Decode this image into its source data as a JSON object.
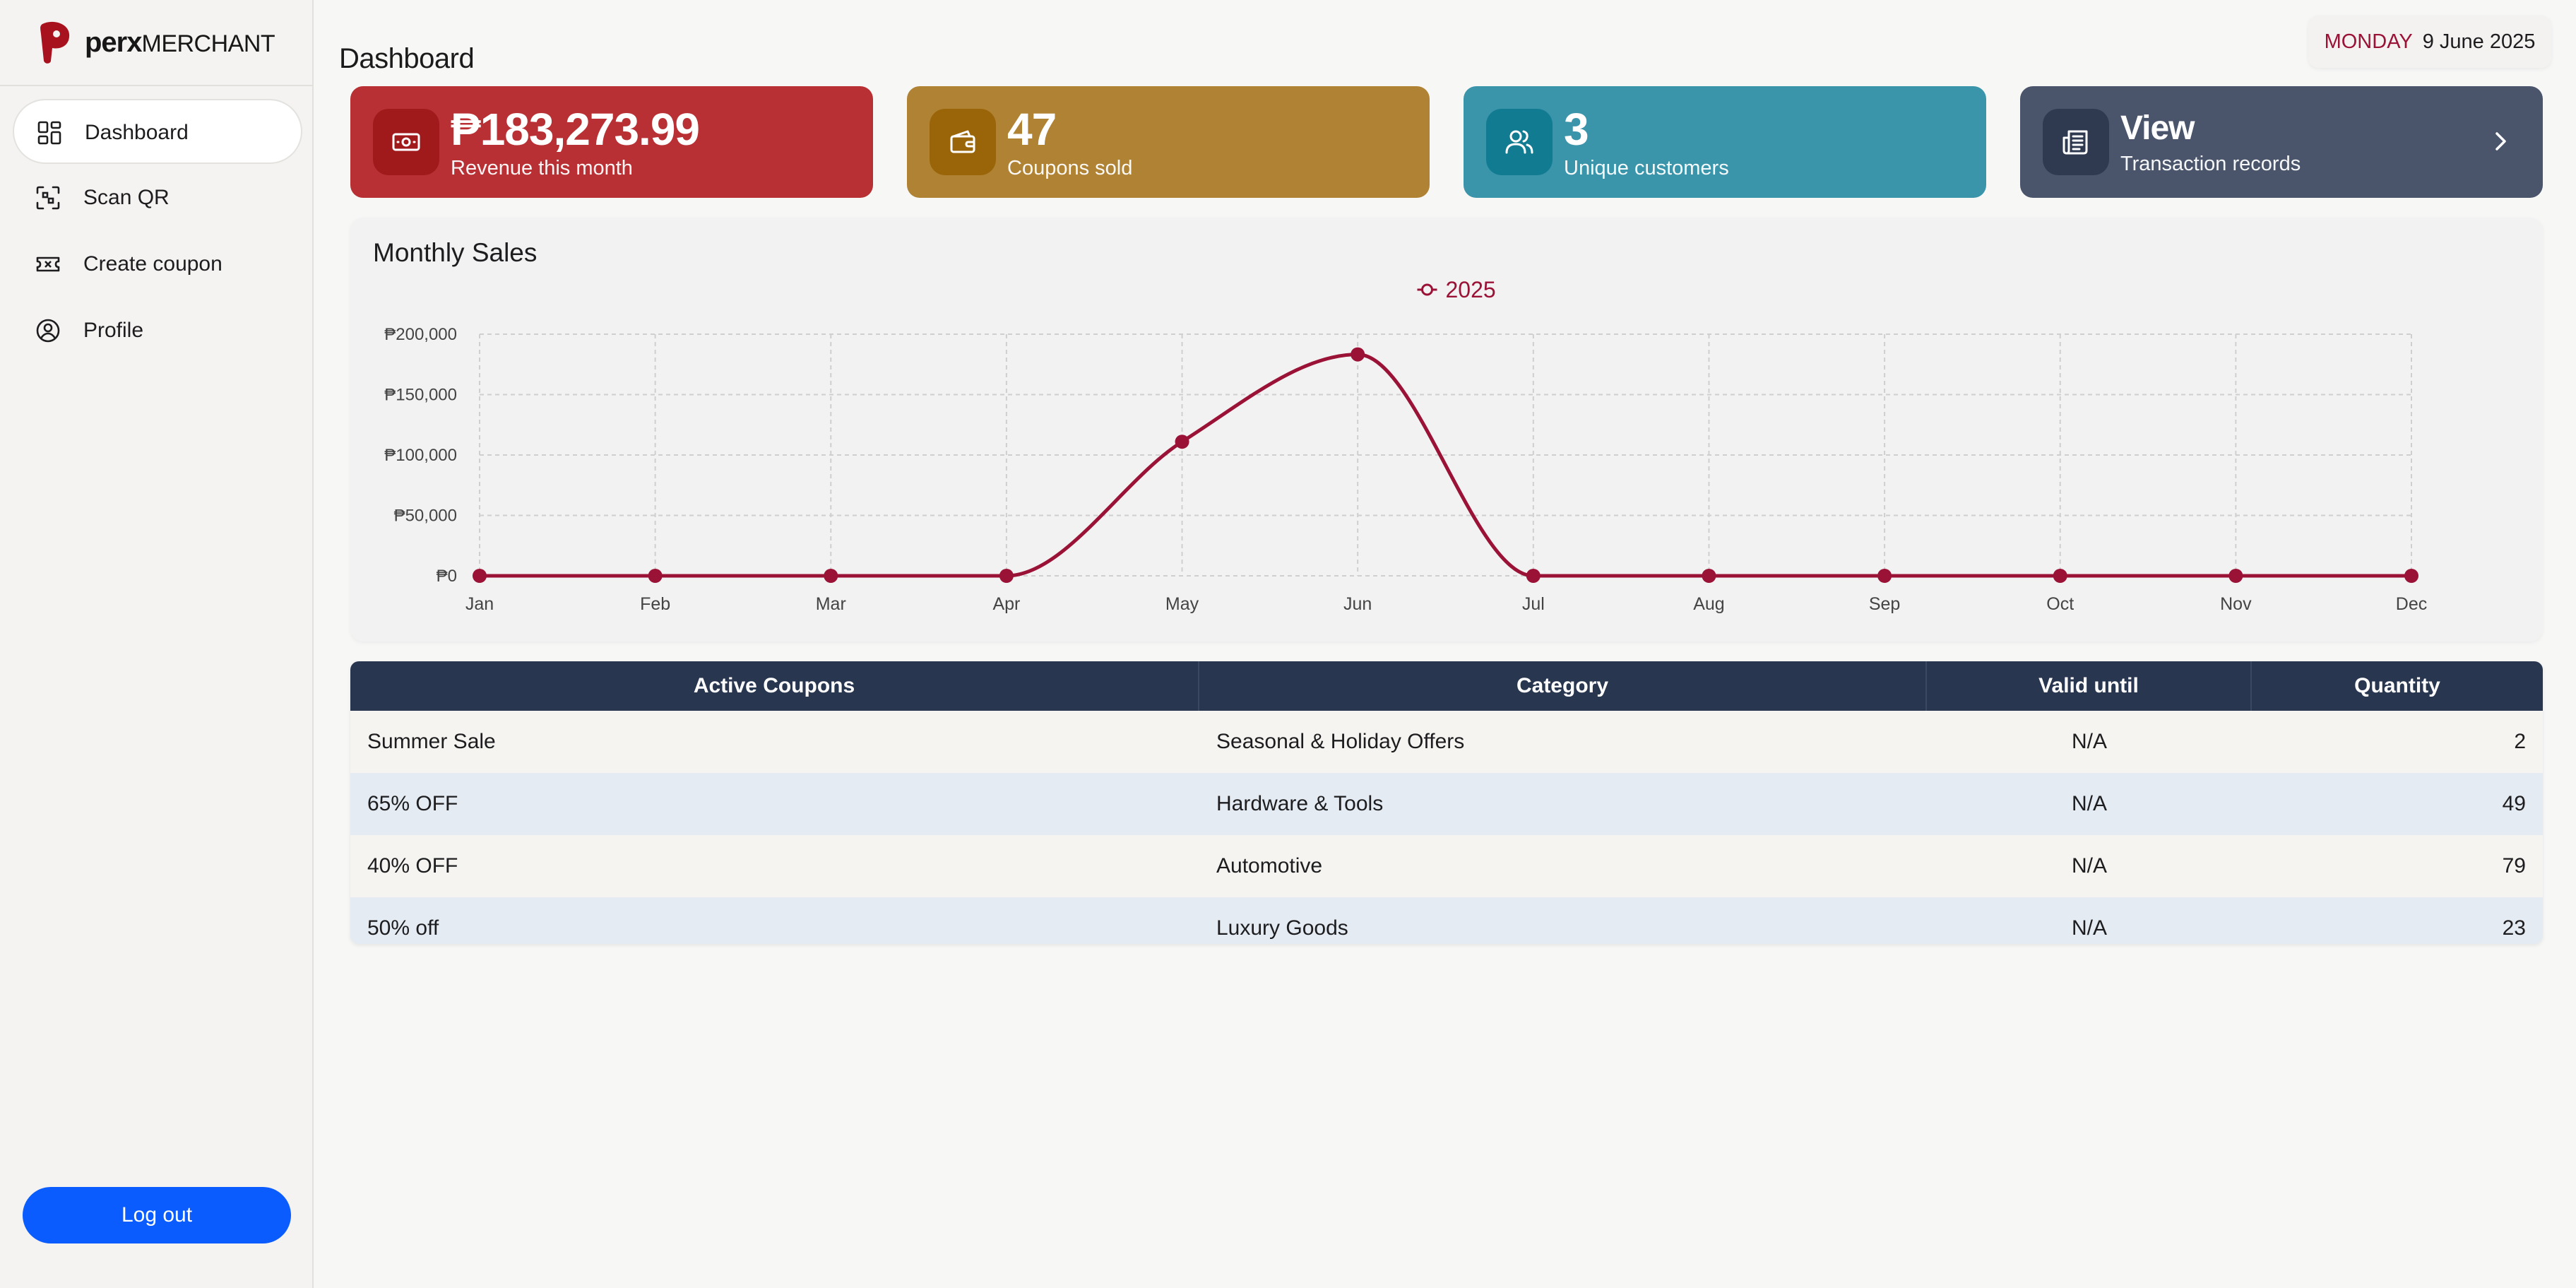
{
  "app": {
    "brand_bold": "perx",
    "brand_light": "MERCHANT"
  },
  "sidebar": {
    "items": [
      {
        "label": "Dashboard",
        "icon": "dashboard-grid-icon",
        "active": true
      },
      {
        "label": "Scan QR",
        "icon": "scan-qr-icon",
        "active": false
      },
      {
        "label": "Create coupon",
        "icon": "ticket-icon",
        "active": false
      },
      {
        "label": "Profile",
        "icon": "user-circle-icon",
        "active": false
      }
    ],
    "logout_label": "Log out"
  },
  "header": {
    "title": "Dashboard",
    "day": "MONDAY",
    "date": "9 June 2025"
  },
  "cards": [
    {
      "value": "₱183,273.99",
      "label": "Revenue this month",
      "icon": "banknote-icon",
      "color": "#b83034",
      "icon_bg": "#a01a1c"
    },
    {
      "value": "47",
      "label": "Coupons sold",
      "icon": "wallet-icon",
      "color": "#b08334",
      "icon_bg": "#9a6508"
    },
    {
      "value": "3",
      "label": "Unique customers",
      "icon": "users-icon",
      "color": "#3a94aa",
      "icon_bg": "#117b92"
    },
    {
      "value": "View",
      "label": "Transaction records",
      "icon": "newspaper-icon",
      "color": "#4a556b",
      "icon_bg": "#2f3a50"
    }
  ],
  "chart_data": {
    "type": "line",
    "title": "Monthly Sales",
    "categories": [
      "Jan",
      "Feb",
      "Mar",
      "Apr",
      "May",
      "Jun",
      "Jul",
      "Aug",
      "Sep",
      "Oct",
      "Nov",
      "Dec"
    ],
    "series": [
      {
        "name": "2025",
        "color": "#9b1237",
        "values": [
          0,
          0,
          0,
          0,
          111000,
          183273.99,
          0,
          0,
          0,
          0,
          0,
          0
        ]
      }
    ],
    "ylim": [
      0,
      200000
    ],
    "yticks": [
      0,
      50000,
      100000,
      150000,
      200000
    ],
    "ytick_labels": [
      "₱0",
      "₱50,000",
      "₱100,000",
      "₱150,000",
      "₱200,000"
    ],
    "grid": true,
    "legend": "top-center"
  },
  "table": {
    "headers": [
      "Active Coupons",
      "Category",
      "Valid until",
      "Quantity"
    ],
    "rows": [
      [
        "Summer Sale",
        "Seasonal & Holiday Offers",
        "N/A",
        "2"
      ],
      [
        "65% OFF",
        "Hardware & Tools",
        "N/A",
        "49"
      ],
      [
        "40% OFF",
        "Automotive",
        "N/A",
        "79"
      ],
      [
        "50% off",
        "Luxury Goods",
        "N/A",
        "23"
      ]
    ]
  }
}
